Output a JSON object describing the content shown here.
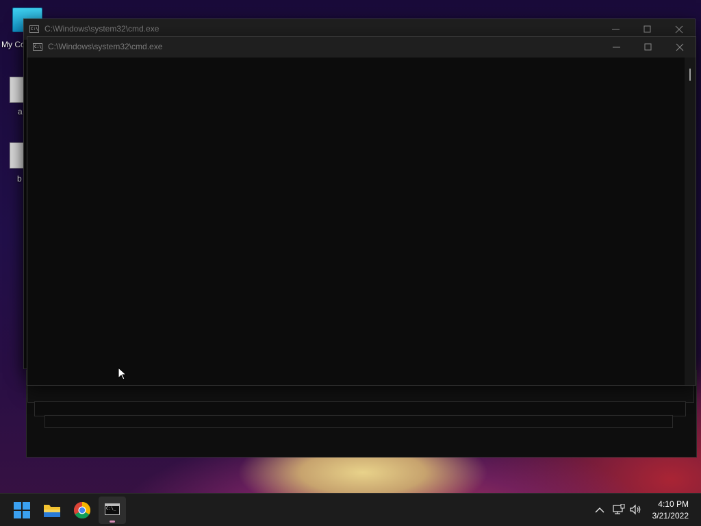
{
  "desktop": {
    "icons": [
      {
        "label": "My Co",
        "icon": "computer-icon"
      },
      {
        "label": "a",
        "icon": "document-icon"
      },
      {
        "label": "b",
        "icon": "document-icon"
      }
    ]
  },
  "windows": {
    "back": {
      "title": "C:\\Windows\\system32\\cmd.exe",
      "icon": "cmd-icon"
    },
    "front": {
      "title": "C:\\Windows\\system32\\cmd.exe",
      "icon": "cmd-icon"
    },
    "controls": {
      "minimize": "minimize-icon",
      "maximize": "maximize-icon",
      "close": "close-icon"
    }
  },
  "taskbar": {
    "items": [
      {
        "name": "start",
        "icon": "windows-logo-icon"
      },
      {
        "name": "file-explorer",
        "icon": "folder-icon"
      },
      {
        "name": "chrome",
        "icon": "chrome-icon"
      },
      {
        "name": "command-prompt",
        "icon": "cmd-icon",
        "active": true
      }
    ],
    "tray": {
      "icons": [
        "chevron-up-icon",
        "network-icon",
        "volume-icon"
      ]
    },
    "clock": {
      "time": "4:10 PM",
      "date": "3/21/2022"
    }
  },
  "colors": {
    "console_bg": "#0c0c0c",
    "titlebar_bg": "#1f1f1f",
    "taskbar_bg": "#1c1c1c",
    "active_indicator": "#d98fb8"
  }
}
